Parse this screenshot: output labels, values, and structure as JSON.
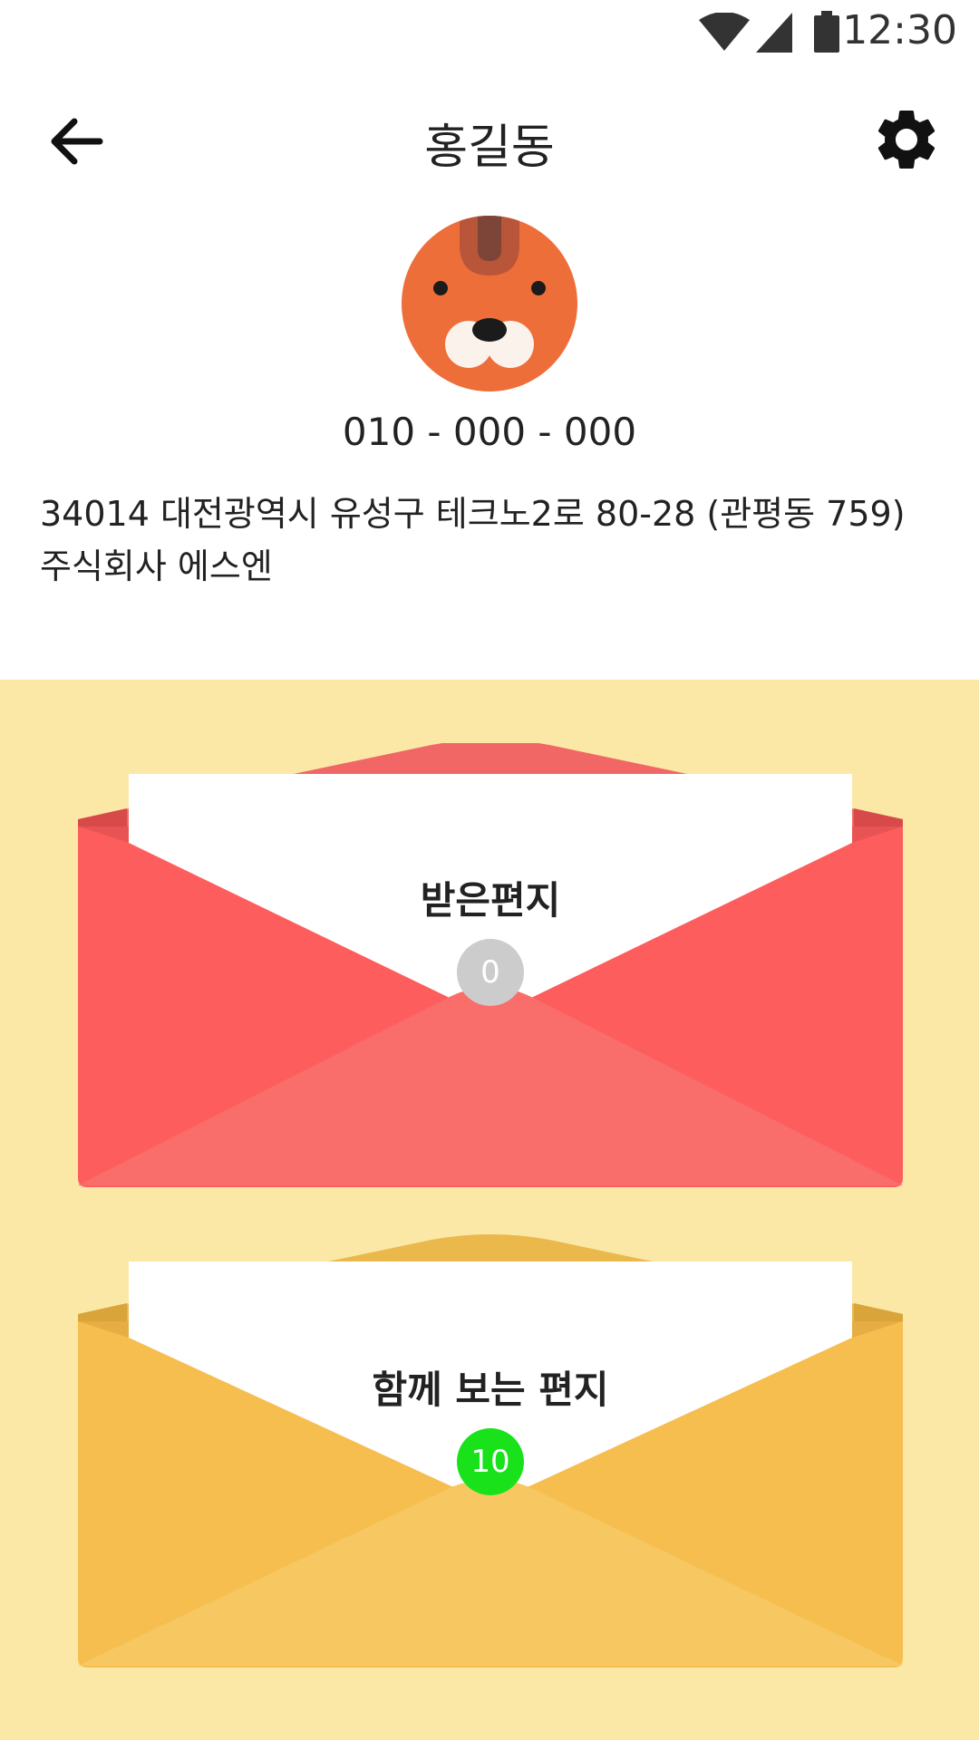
{
  "status_bar": {
    "time": "12:30",
    "icons": [
      "wifi-icon",
      "signal-icon",
      "battery-icon"
    ]
  },
  "header": {
    "title": "홍길동",
    "back_icon": "arrow-left-icon",
    "settings_icon": "gear-icon"
  },
  "profile": {
    "avatar_icon": "beaver-avatar-icon",
    "phone": "010 - 000 - 000",
    "address_line1": "34014 대전광역시 유성구 테크노2로 80-28 (관평동 759)",
    "address_line2": "주식회사 에스엔"
  },
  "mailboxes": [
    {
      "label": "받은편지",
      "count": "0",
      "badge_color": "#cccccc",
      "envelope_color": "#fd5e5d"
    },
    {
      "label": "함께 보는 편지",
      "count": "10",
      "badge_color": "#19e21b",
      "envelope_color": "#f5be4f"
    }
  ],
  "colors": {
    "panel_bg": "#fce8a6",
    "avatar": "#ee6e3a"
  }
}
